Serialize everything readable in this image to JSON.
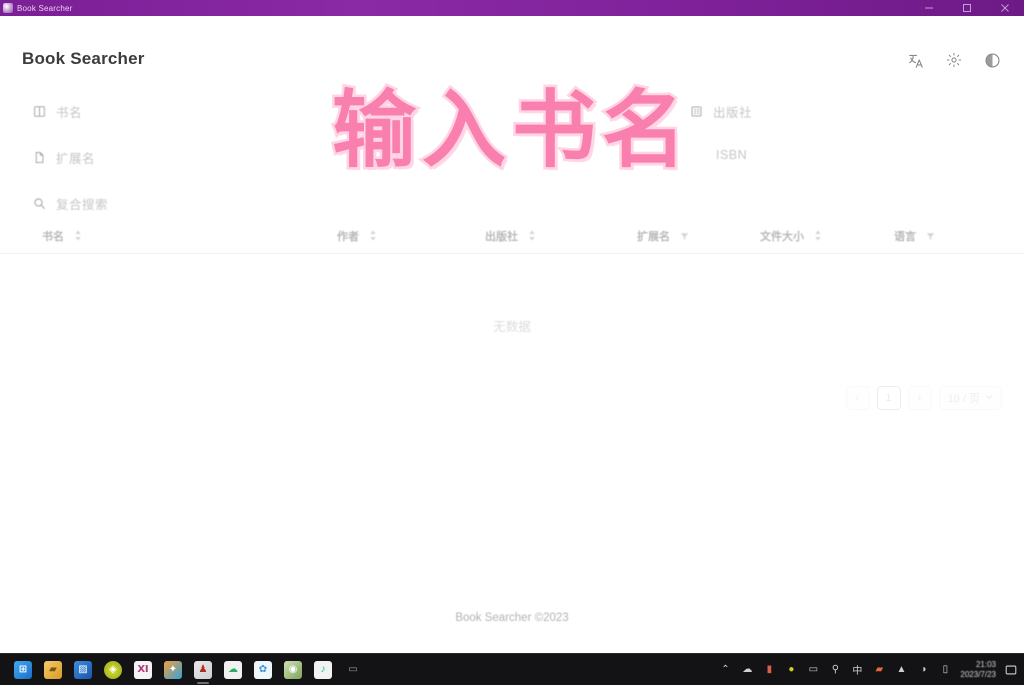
{
  "window": {
    "title": "Book Searcher",
    "icon": "app-icon",
    "controls": [
      {
        "name": "minimize",
        "glyph": "minimize-icon"
      },
      {
        "name": "maximize",
        "glyph": "maximize-icon"
      },
      {
        "name": "close",
        "glyph": "close-icon"
      }
    ]
  },
  "header": {
    "brand": "Book Searcher",
    "icons": [
      {
        "name": "translate-icon",
        "label": "文A"
      },
      {
        "name": "gear-icon",
        "label": "⚙"
      },
      {
        "name": "theme-toggle-icon",
        "label": "◐"
      }
    ]
  },
  "form": {
    "fields": [
      {
        "key": "title",
        "label": "书名",
        "icon": "book-icon",
        "placeholder": "书名"
      },
      {
        "key": "extension",
        "label": "扩展名",
        "icon": "file-icon",
        "placeholder": "扩展名"
      },
      {
        "key": "composite",
        "label": "复合搜索",
        "icon": "search-icon",
        "placeholder": "复合搜索"
      },
      {
        "key": "publisher",
        "label": "出版社",
        "icon": "building-icon",
        "placeholder": "出版社"
      },
      {
        "key": "isbn",
        "label": "ISBN",
        "icon": "barcode-icon",
        "placeholder": "ISBN"
      }
    ]
  },
  "overlay": {
    "text": "输入书名",
    "color": "#f97fae",
    "stroke_color": "#ffd5e4"
  },
  "table": {
    "columns": [
      {
        "label": "书名",
        "control": "sort",
        "glyph": "sort-icon"
      },
      {
        "label": "作者",
        "control": "sort",
        "glyph": "sort-icon"
      },
      {
        "label": "出版社",
        "control": "sort",
        "glyph": "sort-icon"
      },
      {
        "label": "扩展名",
        "control": "filter",
        "glyph": "filter-icon"
      },
      {
        "label": "文件大小",
        "control": "sort",
        "glyph": "sort-icon"
      },
      {
        "label": "语言",
        "control": "filter",
        "glyph": "filter-icon"
      }
    ],
    "rows": [],
    "empty_text": "无数据"
  },
  "pagination": {
    "prev": "‹",
    "pages": [
      "1"
    ],
    "ellipsis": "",
    "next": "›",
    "page_size": "10 / 页"
  },
  "footer": {
    "text": "Book Searcher ©2023"
  },
  "taskbar": {
    "apps": [
      {
        "name": "start-button",
        "glyph": "⊞",
        "color": "#1d8ad1"
      },
      {
        "name": "file-explorer",
        "glyph": "🗀",
        "color": "#e8b84b"
      },
      {
        "name": "microsoft-store",
        "glyph": "▨",
        "color": "#1f6fd0"
      },
      {
        "name": "app-green-diamond",
        "glyph": "◈",
        "color": "#c9d21f"
      },
      {
        "name": "app-x-editor",
        "glyph": "Ⅺ",
        "color": "#ffffff"
      },
      {
        "name": "app-butterfly",
        "glyph": "✦",
        "color": "#e8762c"
      },
      {
        "name": "app-red-person",
        "glyph": "♟",
        "color": "#b03030"
      },
      {
        "name": "app-cloud",
        "glyph": "☁",
        "color": "#2fae6a"
      },
      {
        "name": "app-paint",
        "glyph": "✿",
        "color": "#3d93d8"
      },
      {
        "name": "app-package",
        "glyph": "◉",
        "color": "#7ea55a"
      },
      {
        "name": "app-qq-music",
        "glyph": "♪",
        "color": "#22c07a"
      },
      {
        "name": "app-screen-record",
        "glyph": "▭",
        "color": "#8a8a90"
      }
    ],
    "tray": [
      {
        "name": "show-hidden-icons-chevron",
        "glyph": "⌃"
      },
      {
        "name": "tray-cloud-icon",
        "glyph": "☁"
      },
      {
        "name": "tray-thermometer-icon",
        "glyph": "🌡"
      },
      {
        "name": "tray-green-circle-icon",
        "glyph": "●"
      },
      {
        "name": "tray-monitor-icon",
        "glyph": "▭"
      },
      {
        "name": "tray-pin-icon",
        "glyph": "⚲"
      },
      {
        "name": "tray-ime-icon",
        "glyph": "中"
      },
      {
        "name": "tray-red-icon",
        "glyph": "▰"
      },
      {
        "name": "tray-network-icon",
        "glyph": "▲"
      },
      {
        "name": "tray-volume-icon",
        "glyph": "◑"
      },
      {
        "name": "tray-battery-icon",
        "glyph": "▯"
      }
    ],
    "clock": {
      "time": "21:03",
      "date": "2023/7/23"
    },
    "notification": "▮"
  }
}
